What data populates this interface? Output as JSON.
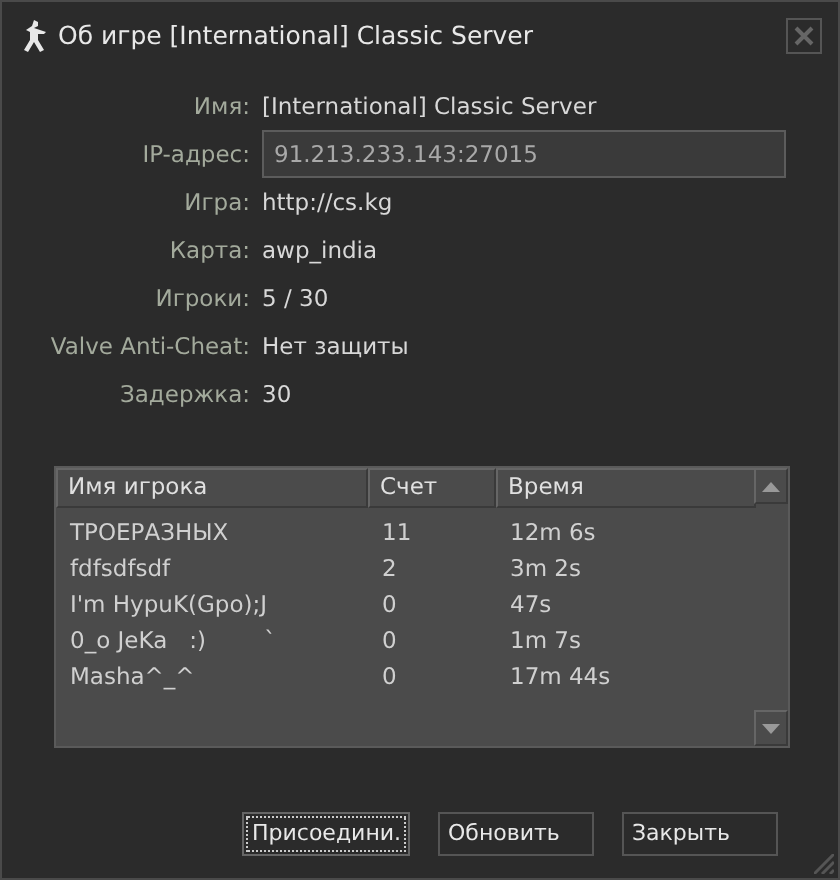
{
  "window": {
    "title": "Об игре [International] Classic Server"
  },
  "info": [
    {
      "label": "Имя:",
      "value": "[International] Classic Server",
      "kind": "text"
    },
    {
      "label": "IP-адрес:",
      "value": "91.213.233.143:27015",
      "kind": "field"
    },
    {
      "label": "Игра:",
      "value": "http://cs.kg",
      "kind": "text"
    },
    {
      "label": "Карта:",
      "value": "awp_india",
      "kind": "text"
    },
    {
      "label": "Игроки:",
      "value": "5 / 30",
      "kind": "text"
    },
    {
      "label": "Valve Anti-Cheat:",
      "value": "Нет защиты",
      "kind": "text"
    },
    {
      "label": "Задержка:",
      "value": "30",
      "kind": "text"
    }
  ],
  "table": {
    "columns": [
      "Имя игрока",
      "Счет",
      "Время"
    ],
    "rows": [
      [
        "ТРОЕРАЗНЫХ",
        "11",
        "12m 6s"
      ],
      [
        "fdfsdfsdf",
        "2",
        "3m 2s"
      ],
      [
        "I'm HypuK(Gpo);J",
        "0",
        "47s"
      ],
      [
        "0_o JeKa   :)        `",
        "0",
        "1m 7s"
      ],
      [
        "Masha^_^",
        "0",
        "17m 44s"
      ]
    ]
  },
  "buttons": [
    {
      "label": "Присоедини.",
      "focused": true
    },
    {
      "label": "Обновить",
      "focused": false
    },
    {
      "label": "Закрыть",
      "focused": false
    }
  ]
}
